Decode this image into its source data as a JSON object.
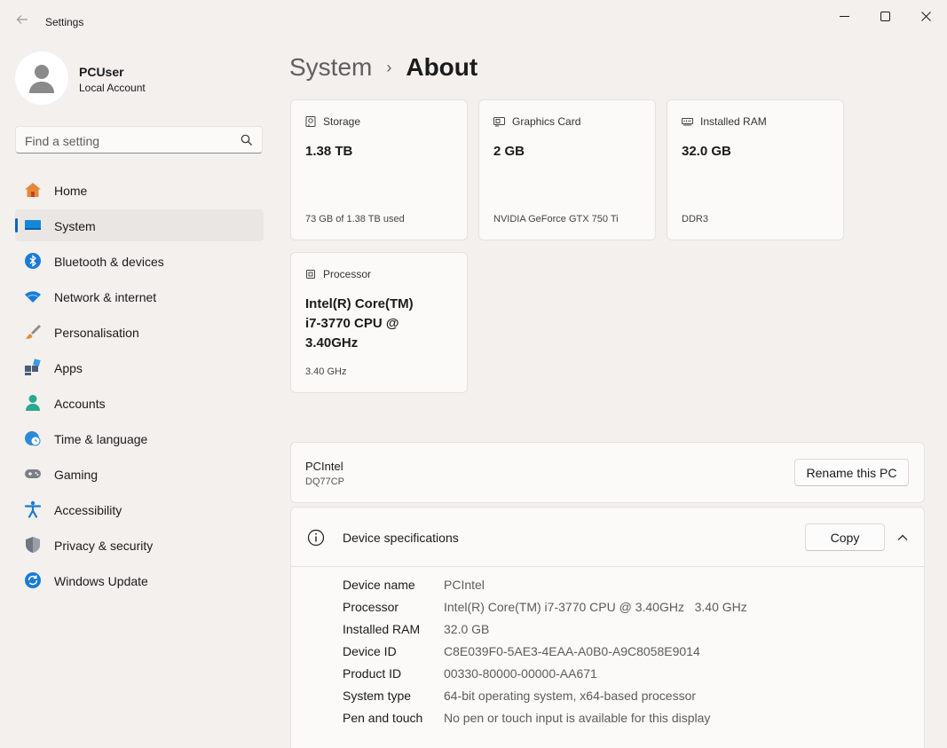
{
  "window": {
    "title": "Settings",
    "back_icon": "arrow-left-icon",
    "minimize_icon": "minimize-icon",
    "maximize_icon": "maximize-icon",
    "close_icon": "close-icon"
  },
  "user": {
    "name": "PCUser",
    "account_type": "Local Account"
  },
  "search": {
    "placeholder": "Find a setting"
  },
  "sidebar": {
    "items": [
      {
        "label": "Home",
        "icon": "home-icon",
        "active": false
      },
      {
        "label": "System",
        "icon": "system-monitor-icon",
        "active": true
      },
      {
        "label": "Bluetooth & devices",
        "icon": "bluetooth-icon",
        "active": false
      },
      {
        "label": "Network & internet",
        "icon": "wifi-icon",
        "active": false
      },
      {
        "label": "Personalisation",
        "icon": "paintbrush-icon",
        "active": false
      },
      {
        "label": "Apps",
        "icon": "apps-icon",
        "active": false
      },
      {
        "label": "Accounts",
        "icon": "person-icon",
        "active": false
      },
      {
        "label": "Time & language",
        "icon": "globe-clock-icon",
        "active": false
      },
      {
        "label": "Gaming",
        "icon": "gamepad-icon",
        "active": false
      },
      {
        "label": "Accessibility",
        "icon": "accessibility-icon",
        "active": false
      },
      {
        "label": "Privacy & security",
        "icon": "shield-icon",
        "active": false
      },
      {
        "label": "Windows Update",
        "icon": "update-icon",
        "active": false
      }
    ]
  },
  "breadcrumb": {
    "parent": "System",
    "separator": "›",
    "current": "About"
  },
  "cards": {
    "storage": {
      "title": "Storage",
      "value": "1.38 TB",
      "sub": "73 GB of 1.38 TB used",
      "icon": "storage-icon"
    },
    "graphics": {
      "title": "Graphics Card",
      "value": "2 GB",
      "sub": "NVIDIA GeForce GTX 750 Ti",
      "icon": "graphics-card-icon"
    },
    "ram": {
      "title": "Installed RAM",
      "value": "32.0 GB",
      "sub": "DDR3",
      "icon": "ram-icon"
    },
    "processor": {
      "title": "Processor",
      "value_lines": [
        "Intel(R) Core(TM)",
        "i7-3770 CPU @",
        "3.40GHz"
      ],
      "sub": "3.40 GHz",
      "icon": "processor-icon"
    }
  },
  "pc": {
    "name": "PCIntel",
    "model": "DQ77CP",
    "rename_label": "Rename this PC"
  },
  "specs": {
    "title": "Device specifications",
    "copy_label": "Copy",
    "rows": [
      {
        "key": "Device name",
        "value": "PCIntel"
      },
      {
        "key": "Processor",
        "value": "Intel(R) Core(TM) i7-3770 CPU @ 3.40GHz   3.40 GHz"
      },
      {
        "key": "Installed RAM",
        "value": "32.0 GB"
      },
      {
        "key": "Device ID",
        "value": "C8E039F0-5AE3-4EAA-A0B0-A9C8058E9014"
      },
      {
        "key": "Product ID",
        "value": "00330-80000-00000-AA671"
      },
      {
        "key": "System type",
        "value": "64-bit operating system, x64-based processor"
      },
      {
        "key": "Pen and touch",
        "value": "No pen or touch input is available for this display"
      }
    ]
  },
  "colors": {
    "accent": "#0a63c8",
    "background": "#f3f0ee",
    "card": "#fbfaf9"
  }
}
